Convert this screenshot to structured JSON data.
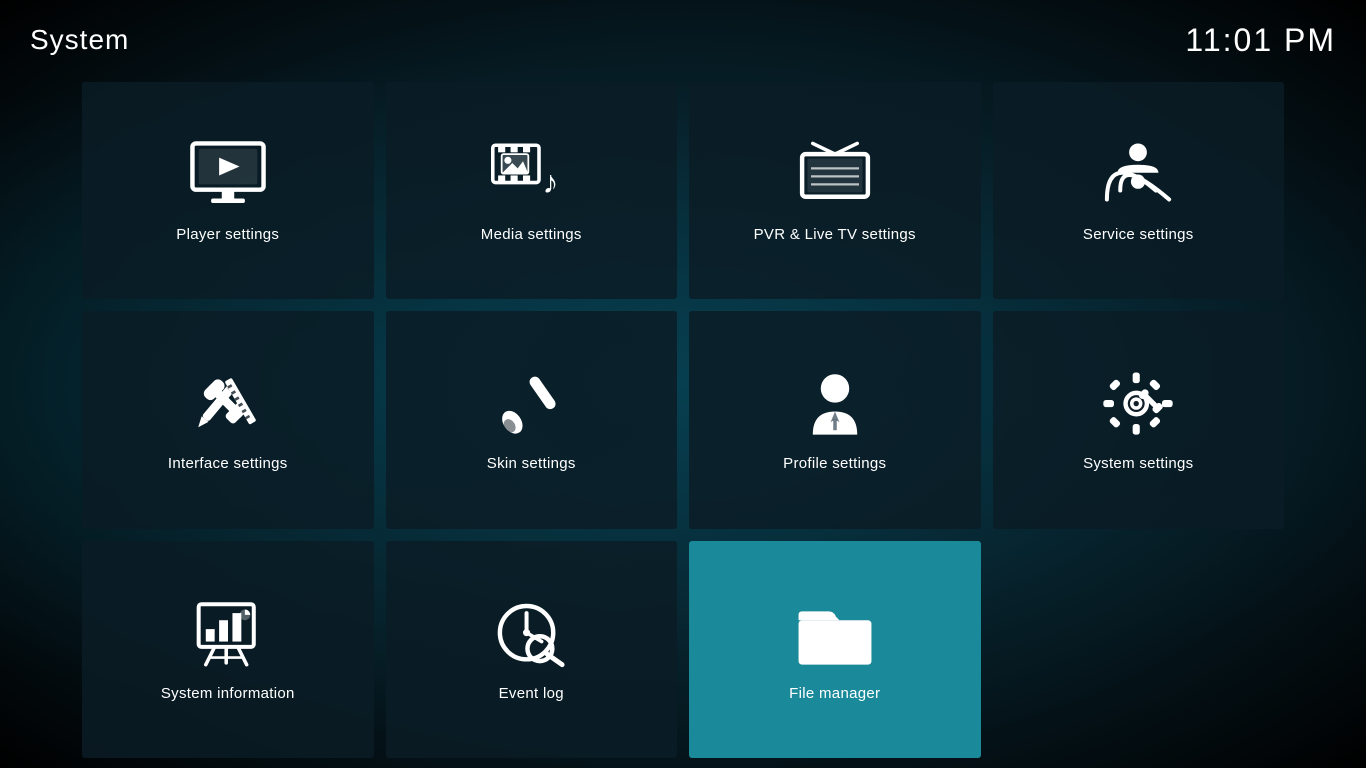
{
  "header": {
    "title": "System",
    "clock": "11:01 PM"
  },
  "tiles": [
    {
      "id": "player-settings",
      "label": "Player settings",
      "icon": "player",
      "active": false
    },
    {
      "id": "media-settings",
      "label": "Media settings",
      "icon": "media",
      "active": false
    },
    {
      "id": "pvr-settings",
      "label": "PVR & Live TV settings",
      "icon": "pvr",
      "active": false
    },
    {
      "id": "service-settings",
      "label": "Service settings",
      "icon": "service",
      "active": false
    },
    {
      "id": "interface-settings",
      "label": "Interface settings",
      "icon": "interface",
      "active": false
    },
    {
      "id": "skin-settings",
      "label": "Skin settings",
      "icon": "skin",
      "active": false
    },
    {
      "id": "profile-settings",
      "label": "Profile settings",
      "icon": "profile",
      "active": false
    },
    {
      "id": "system-settings",
      "label": "System settings",
      "icon": "systemsettings",
      "active": false
    },
    {
      "id": "system-information",
      "label": "System information",
      "icon": "sysinfo",
      "active": false
    },
    {
      "id": "event-log",
      "label": "Event log",
      "icon": "eventlog",
      "active": false
    },
    {
      "id": "file-manager",
      "label": "File manager",
      "icon": "filemanager",
      "active": true
    }
  ]
}
